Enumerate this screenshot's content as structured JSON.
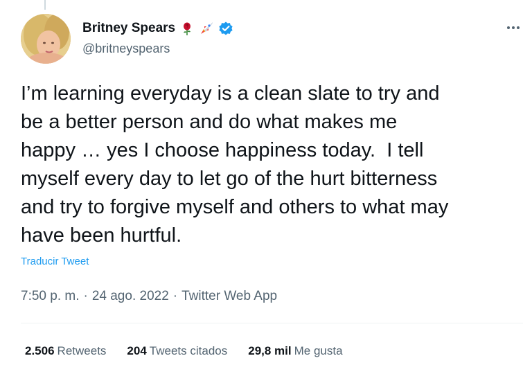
{
  "user": {
    "display_name": "Britney Spears",
    "emojis": [
      "rose-emoji",
      "rocket-emoji"
    ],
    "verified": true,
    "handle": "@britneyspears"
  },
  "tweet": {
    "text": "I’m learning everyday is a clean slate to try and\nbe a better person and do what makes me\nhappy … yes I choose happiness today.  I tell\nmyself every day to let go of the hurt bitterness\nand try to forgive myself and others to what may\nhave been hurtful.",
    "translate_label": "Traducir Tweet"
  },
  "meta": {
    "time": "7:50 p. m.",
    "separator": "·",
    "date": "24 ago. 2022",
    "source": "Twitter Web App"
  },
  "stats": {
    "retweets": {
      "count": "2.506",
      "label": "Retweets"
    },
    "quotes": {
      "count": "204",
      "label": "Tweets citados"
    },
    "likes": {
      "count": "29,8 mil",
      "label": "Me gusta"
    }
  },
  "colors": {
    "accent": "#1d9bf0",
    "text_primary": "#0f1419",
    "text_secondary": "#536471",
    "verified": "#1d9bf0"
  }
}
